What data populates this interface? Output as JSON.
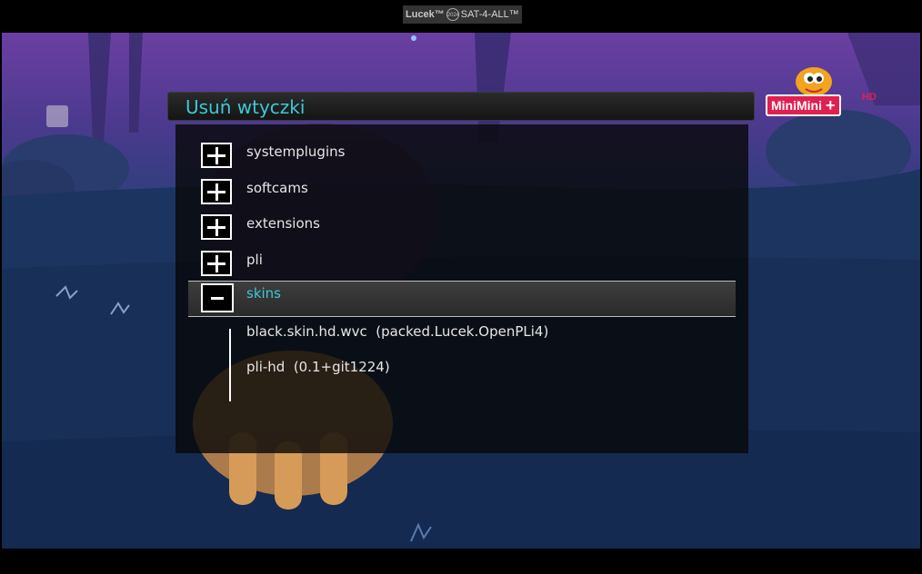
{
  "watermark": {
    "brand": "Lucek™",
    "badge": "2024",
    "text": "SAT-4-ALL™"
  },
  "channel": {
    "logo_text": "MiniMini",
    "logo_plus": "+",
    "hd": "HD"
  },
  "dialog": {
    "title": "Usuń wtyczki",
    "items": [
      {
        "label": "systemplugins",
        "type": "category",
        "expanded": false
      },
      {
        "label": "softcams",
        "type": "category",
        "expanded": false
      },
      {
        "label": "extensions",
        "type": "category",
        "expanded": false
      },
      {
        "label": "pli",
        "type": "category",
        "expanded": false
      },
      {
        "label": "skins",
        "type": "category",
        "expanded": true,
        "selected": true
      },
      {
        "label": "black.skin.hd.wvc  (packed.Lucek.OpenPLi4)",
        "type": "plugin"
      },
      {
        "label": "pli-hd  (0.1+git1224)",
        "type": "plugin"
      }
    ]
  },
  "colors": {
    "accent": "#3ec8d8",
    "text": "#e6e6e6",
    "logo": "#e02050"
  },
  "icons": {
    "expand": "plus-box-icon",
    "collapse": "minus-box-icon"
  }
}
